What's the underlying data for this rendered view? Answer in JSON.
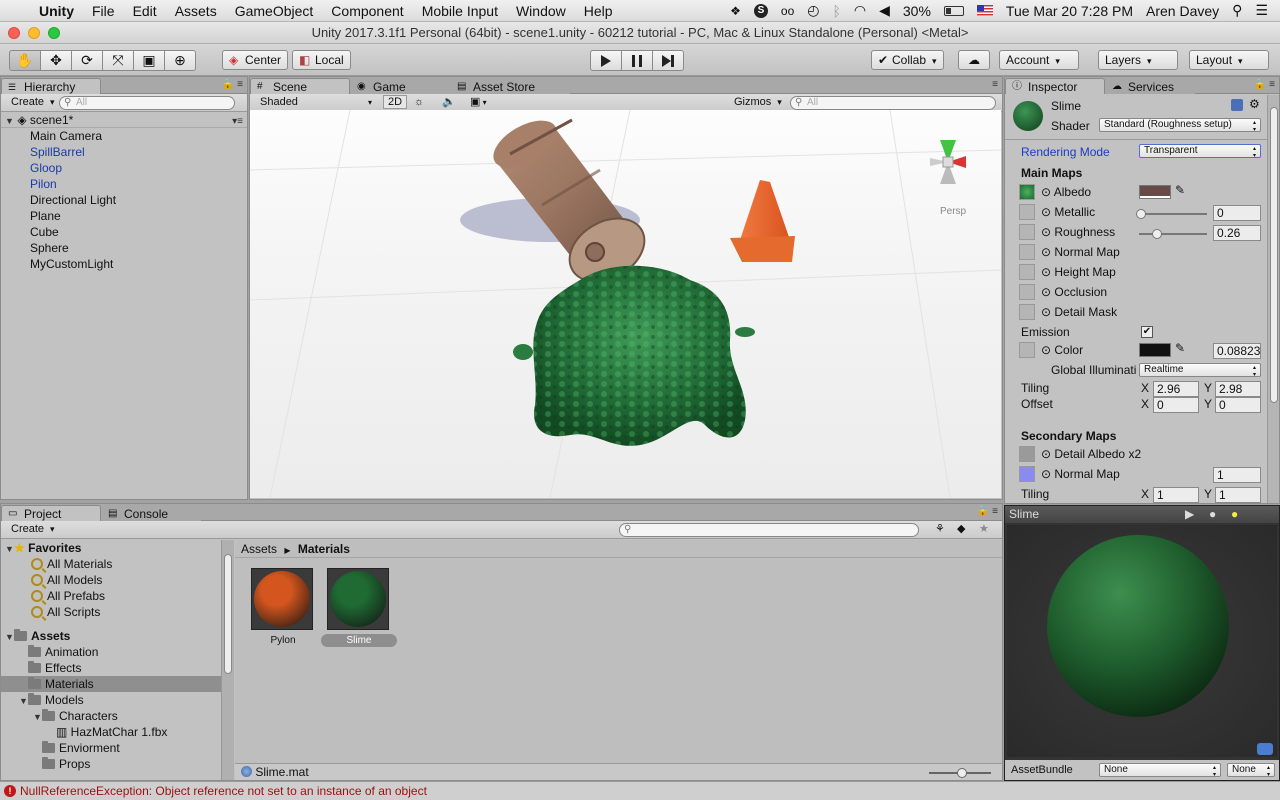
{
  "menubar": {
    "app": "Unity",
    "items": [
      "File",
      "Edit",
      "Assets",
      "GameObject",
      "Component",
      "Mobile Input",
      "Window",
      "Help"
    ],
    "battery": "30%",
    "clock": "Tue Mar 20  7:28 PM",
    "user": "Aren Davey"
  },
  "window": {
    "title": "Unity 2017.3.1f1 Personal (64bit) - scene1.unity - 60212 tutorial - PC, Mac & Linux Standalone (Personal) <Metal>"
  },
  "toolbar": {
    "pivot": "Center",
    "space": "Local",
    "collab": "Collab",
    "account": "Account",
    "layers": "Layers",
    "layout": "Layout"
  },
  "hierarchy": {
    "tab": "Hierarchy",
    "create": "Create",
    "search_placeholder": "All",
    "scene": "scene1*",
    "items": [
      {
        "label": "Main Camera",
        "blue": false
      },
      {
        "label": "SpillBarrel",
        "blue": true
      },
      {
        "label": "Gloop",
        "blue": true
      },
      {
        "label": "Pilon",
        "blue": true
      },
      {
        "label": "Directional Light",
        "blue": false
      },
      {
        "label": "Plane",
        "blue": false
      },
      {
        "label": "Cube",
        "blue": false
      },
      {
        "label": "Sphere",
        "blue": false
      },
      {
        "label": "MyCustomLight",
        "blue": false
      }
    ]
  },
  "scene_view": {
    "tabs": [
      "Scene",
      "Game",
      "Asset Store"
    ],
    "shading": "Shaded",
    "mode_2d": "2D",
    "gizmos": "Gizmos",
    "search_placeholder": "All",
    "persp": "Persp"
  },
  "inspector": {
    "tabs": [
      "Inspector",
      "Services"
    ],
    "material_name": "Slime",
    "shader_label": "Shader",
    "shader_value": "Standard (Roughness setup)",
    "rendering_mode_label": "Rendering Mode",
    "rendering_mode_value": "Transparent",
    "main_maps": "Main Maps",
    "albedo": "Albedo",
    "metallic": "Metallic",
    "metallic_value": "0",
    "roughness": "Roughness",
    "roughness_value": "0.26",
    "normal_map": "Normal Map",
    "height_map": "Height Map",
    "occlusion": "Occlusion",
    "detail_mask": "Detail Mask",
    "emission": "Emission",
    "color": "Color",
    "color_value": "0.08823",
    "global_illum": "Global Illuminati",
    "global_illum_value": "Realtime",
    "tiling": "Tiling",
    "tiling_x": "2.96",
    "tiling_y": "2.98",
    "offset": "Offset",
    "offset_x": "0",
    "offset_y": "0",
    "x_label": "X",
    "y_label": "Y",
    "secondary_maps": "Secondary Maps",
    "detail_albedo": "Detail Albedo x2",
    "sec_normal_map": "Normal Map",
    "sec_normal_value": "1",
    "sec_tiling": "Tiling",
    "sec_tiling_x": "1",
    "sec_tiling_y": "1"
  },
  "preview": {
    "title": "Slime",
    "assetbundle_label": "AssetBundle",
    "assetbundle_value": "None",
    "variant_value": "None"
  },
  "project": {
    "tabs": [
      "Project",
      "Console"
    ],
    "create": "Create",
    "favorites": "Favorites",
    "favorite_items": [
      "All Materials",
      "All Models",
      "All Prefabs",
      "All Scripts"
    ],
    "assets": "Assets",
    "tree": [
      {
        "label": "Animation",
        "indent": 1
      },
      {
        "label": "Effects",
        "indent": 1
      },
      {
        "label": "Materials",
        "indent": 1,
        "selected": true
      },
      {
        "label": "Models",
        "indent": 1,
        "open": true
      },
      {
        "label": "Characters",
        "indent": 2,
        "open": true
      },
      {
        "label": "HazMatChar 1.fbx",
        "indent": 3
      },
      {
        "label": "Enviorment",
        "indent": 2
      },
      {
        "label": "Props",
        "indent": 2
      }
    ],
    "breadcrumb_root": "Assets",
    "breadcrumb_current": "Materials",
    "assets_items": [
      {
        "label": "Pylon",
        "color": "#d4561e"
      },
      {
        "label": "Slime",
        "color": "#1f6b33"
      }
    ],
    "selected_file": "Slime.mat"
  },
  "status": {
    "message": "NullReferenceException: Object reference not set to an instance of an object"
  }
}
